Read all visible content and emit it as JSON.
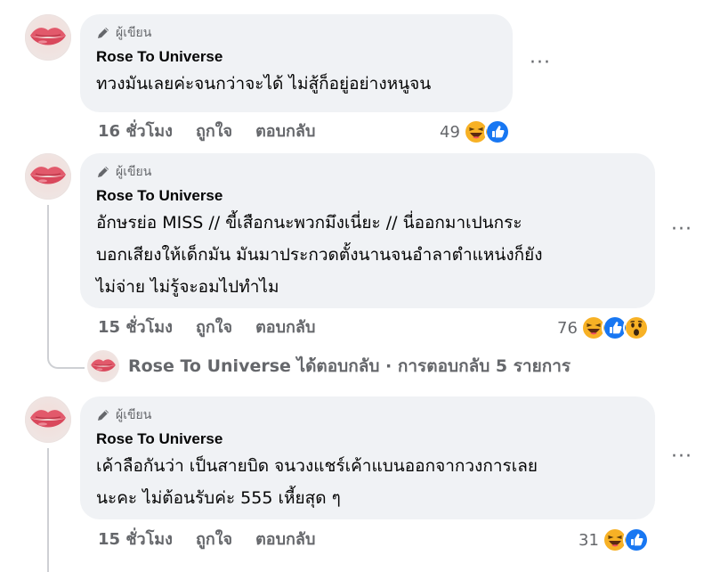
{
  "comments": [
    {
      "badge": "ผู้เขียน",
      "author": "Rose To Universe",
      "text": "ทวงมันเลยค่ะจนกว่าจะได้ ไม่สู้ก็อยู่อย่างหนูจน",
      "time": "16 ชั่วโมง",
      "like": "ถูกใจ",
      "reply": "ตอบกลับ",
      "reaction_count": "49",
      "reactions": [
        "haha-icon",
        "like-icon"
      ],
      "more": "···"
    },
    {
      "badge": "ผู้เขียน",
      "author": "Rose To Universe",
      "text": "อักษรย่อ MISS // ขี้เสือกนะพวกมึงเนี่ยะ // นี่ออกมาเปนกระ\nบอกเสียงให้เด็กมัน มันมาประกวดตั้งนานจนอำลาตำแหน่งก็ยัง\nไม่จ่าย ไม่รู้จะอมไปทำไม",
      "time": "15 ชั่วโมง",
      "like": "ถูกใจ",
      "reply": "ตอบกลับ",
      "reaction_count": "76",
      "reactions": [
        "haha-icon",
        "like-icon",
        "wow-icon"
      ],
      "more": "···"
    },
    {
      "badge": "ผู้เขียน",
      "author": "Rose To Universe",
      "text": "เค้าลือกันว่า เป็นสายบิด จนวงแชร์เค้าแบนออกจากวงการเลย\nนะคะ ไม่ต้อนรับค่ะ 555 เหี้ยสุด ๆ",
      "time": "15 ชั่วโมง",
      "like": "ถูกใจ",
      "reply": "ตอบกลับ",
      "reaction_count": "31",
      "reactions": [
        "haha-icon",
        "like-icon"
      ],
      "more": "···"
    }
  ],
  "replies_summary": "Rose To Universe ได้ตอบกลับ · การตอบกลับ 5 รายการ",
  "colors": {
    "bubble": "#f0f2f5",
    "secondary_text": "#65676b",
    "like_blue": "#1877f2",
    "emoji_yellow": "#f7b125"
  }
}
